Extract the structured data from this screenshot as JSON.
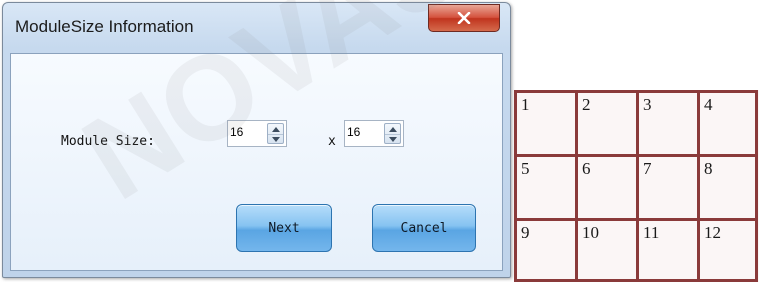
{
  "dialog": {
    "title": "ModuleSize Information",
    "module_size_label": "Module Size:",
    "width_value": "16",
    "separator": "x",
    "height_value": "16",
    "next_label": "Next",
    "cancel_label": "Cancel"
  },
  "grid": {
    "cells": [
      "1",
      "2",
      "3",
      "4",
      "5",
      "6",
      "7",
      "8",
      "9",
      "10",
      "11",
      "12"
    ]
  },
  "watermark": "NOVASTAR",
  "colors": {
    "close_button": "#c7432d",
    "button_accent": "#6fb3ea",
    "grid_border": "#8a3a3a"
  }
}
